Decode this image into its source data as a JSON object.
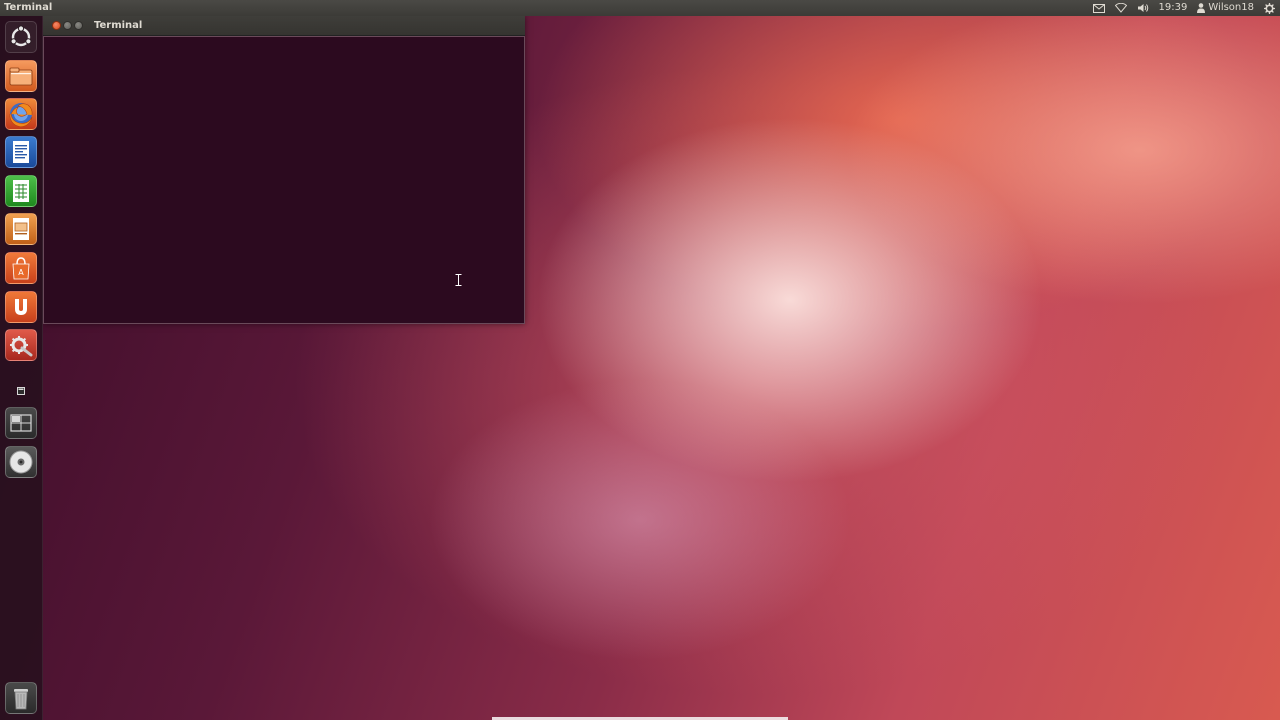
{
  "top_panel": {
    "active_app_title": "Terminal",
    "clock": "19:39",
    "user_name": "Wilson18",
    "icons": [
      "mail-icon",
      "network-icon",
      "volume-icon",
      "user-icon",
      "session-gear-icon"
    ]
  },
  "launcher": {
    "items": [
      {
        "name": "dash-home",
        "icon": "ubuntu-logo-icon"
      },
      {
        "name": "files",
        "icon": "folder-icon"
      },
      {
        "name": "firefox",
        "icon": "firefox-icon"
      },
      {
        "name": "libreoffice-writer",
        "icon": "writer-document-icon"
      },
      {
        "name": "libreoffice-calc",
        "icon": "calc-spreadsheet-icon"
      },
      {
        "name": "libreoffice-impress",
        "icon": "impress-presentation-icon"
      },
      {
        "name": "software-center",
        "icon": "shopping-bag-icon"
      },
      {
        "name": "ubuntu-one",
        "icon": "ubuntu-one-icon"
      },
      {
        "name": "system-settings",
        "icon": "settings-wrench-icon"
      },
      {
        "name": "terminal",
        "icon": "terminal-icon"
      },
      {
        "name": "workspace-switcher",
        "icon": "workspace-icon"
      },
      {
        "name": "optical-drive",
        "icon": "cd-icon"
      },
      {
        "name": "trash",
        "icon": "trash-icon"
      }
    ]
  },
  "terminal_window": {
    "title": "Terminal",
    "content": "",
    "background_color": "#2c0a1f"
  },
  "colors": {
    "panel": "#3c3b37",
    "close_button": "#df4a16",
    "terminal_bg": "#2c0a1f",
    "ubuntu_orange": "#e95420"
  }
}
